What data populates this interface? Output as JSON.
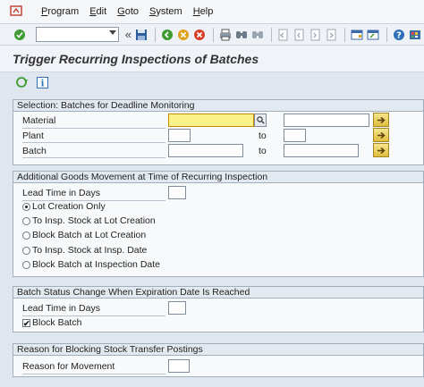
{
  "menu": {
    "items": [
      {
        "label": "Program",
        "key": "P",
        "rest": "rogram"
      },
      {
        "label": "Edit",
        "key": "E",
        "rest": "dit"
      },
      {
        "label": "Goto",
        "key": "G",
        "rest": "oto"
      },
      {
        "label": "System",
        "key": "S",
        "rest": "ystem"
      },
      {
        "label": "Help",
        "key": "H",
        "rest": "elp"
      }
    ]
  },
  "toolbar": {
    "command_field": "",
    "icons": [
      "enter-icon",
      "save-icon",
      "back-icon",
      "exit-icon",
      "cancel-icon",
      "print-icon",
      "find-icon",
      "find-next-icon",
      "first-page-icon",
      "previous-page-icon",
      "next-page-icon",
      "last-page-icon",
      "new-session-icon",
      "shortcut-icon",
      "help-icon",
      "layout-icon"
    ]
  },
  "page": {
    "title": "Trigger Recurring Inspections of Batches"
  },
  "app_toolbar": {
    "icons": [
      "execute-icon",
      "information-icon"
    ]
  },
  "selection": {
    "title": "Selection: Batches for Deadline Monitoring",
    "rows": [
      {
        "label": "Material",
        "from": "",
        "to_label": "",
        "to": ""
      },
      {
        "label": "Plant",
        "from": "",
        "to_label": "to",
        "to": ""
      },
      {
        "label": "Batch",
        "from": "",
        "to_label": "to",
        "to": ""
      }
    ]
  },
  "goods_movement": {
    "title": "Additional Goods Movement at Time of Recurring Inspection",
    "lead_time_label": "Lead Time in Days",
    "lead_time_value": "",
    "options": [
      {
        "label": "Lot Creation Only",
        "selected": true
      },
      {
        "label": "To Insp. Stock at Lot Creation",
        "selected": false
      },
      {
        "label": "Block Batch at Lot Creation",
        "selected": false
      },
      {
        "label": "To Insp. Stock at Insp. Date",
        "selected": false
      },
      {
        "label": "Block Batch at Inspection Date",
        "selected": false
      }
    ]
  },
  "batch_status": {
    "title": "Batch Status Change When Expiration Date Is Reached",
    "lead_time_label": "Lead Time in Days",
    "lead_time_value": "",
    "block_batch_label": "Block Batch",
    "block_batch_checked": true,
    "check_mark": "✔"
  },
  "blocking_reason": {
    "title": "Reason for Blocking Stock Transfer Postings",
    "reason_label": "Reason for Movement",
    "reason_value": ""
  },
  "colors": {
    "required_field": "#fbf28a",
    "background": "#dfe6ef",
    "group_header": "#e3e9f0"
  }
}
